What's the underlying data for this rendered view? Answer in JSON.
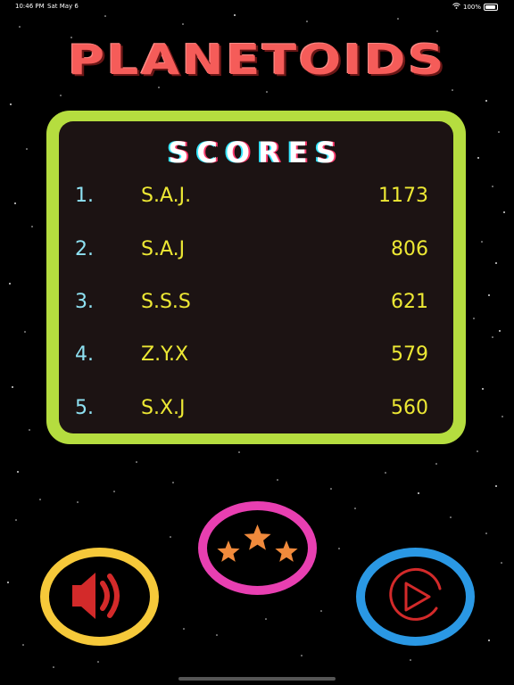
{
  "status_bar": {
    "time": "10:46 PM",
    "date": "Sat May 6",
    "battery": "100%"
  },
  "title": "PLANETOIDS",
  "scores": {
    "heading": "SCORES",
    "rows": [
      {
        "rank": "1.",
        "name": "S.A.J.",
        "score": "1173"
      },
      {
        "rank": "2.",
        "name": "S.A.J",
        "score": "806"
      },
      {
        "rank": "3.",
        "name": "S.S.S",
        "score": "621"
      },
      {
        "rank": "4.",
        "name": "Z.Y.X",
        "score": "579"
      },
      {
        "rank": "5.",
        "name": "S.X.J",
        "score": "560"
      }
    ]
  },
  "buttons": {
    "sound_icon": "speaker-icon",
    "rate_icon": "three-stars-icon",
    "play_icon": "play-icon"
  },
  "colors": {
    "title": "#f55c59",
    "panel_border": "#b5dd3f",
    "rank": "#8ee1f2",
    "name_score": "#ede834",
    "sound_ring": "#f6c93a",
    "rate_ring": "#e83fb1",
    "play_ring": "#2a98e4",
    "star": "#f08a3c",
    "icon_red": "#d32a2a"
  }
}
